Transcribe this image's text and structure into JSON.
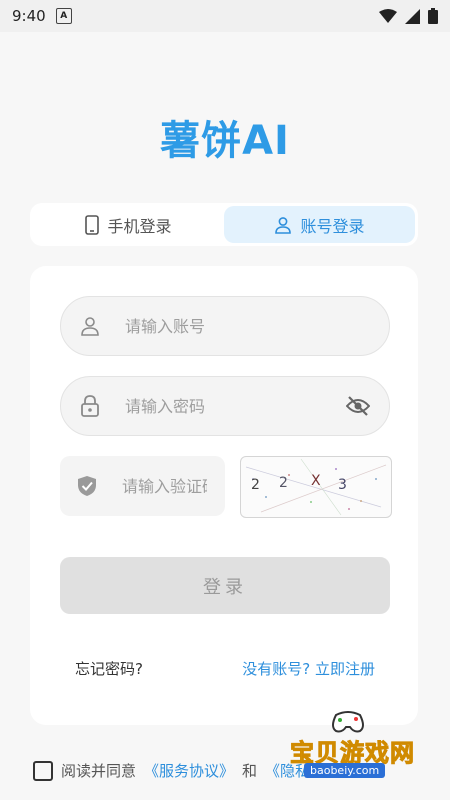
{
  "status_bar": {
    "time": "9:40",
    "notif_letter": "A"
  },
  "app": {
    "title": "薯饼AI"
  },
  "tabs": [
    {
      "label": "手机登录",
      "icon": "phone-icon",
      "active": false
    },
    {
      "label": "账号登录",
      "icon": "user-icon",
      "active": true
    }
  ],
  "form": {
    "account_placeholder": "请输入账号",
    "password_placeholder": "请输入密码",
    "code_placeholder": "请输入验证码",
    "captcha_chars": [
      "2",
      "2",
      "X",
      "3"
    ],
    "login_label": "登录",
    "forgot_label": "忘记密码?",
    "register_label": "没有账号? 立即注册"
  },
  "agreement": {
    "prefix": "阅读并同意",
    "terms": "《服务协议》",
    "and": "和",
    "privacy": "《隐私政策》"
  },
  "watermark": {
    "name": "宝贝游戏网",
    "url": "baobeiy.com"
  },
  "colors": {
    "accent": "#2e9be6",
    "tab_active_bg": "#e3f2fd",
    "button_disabled": "#e0e0e0"
  }
}
